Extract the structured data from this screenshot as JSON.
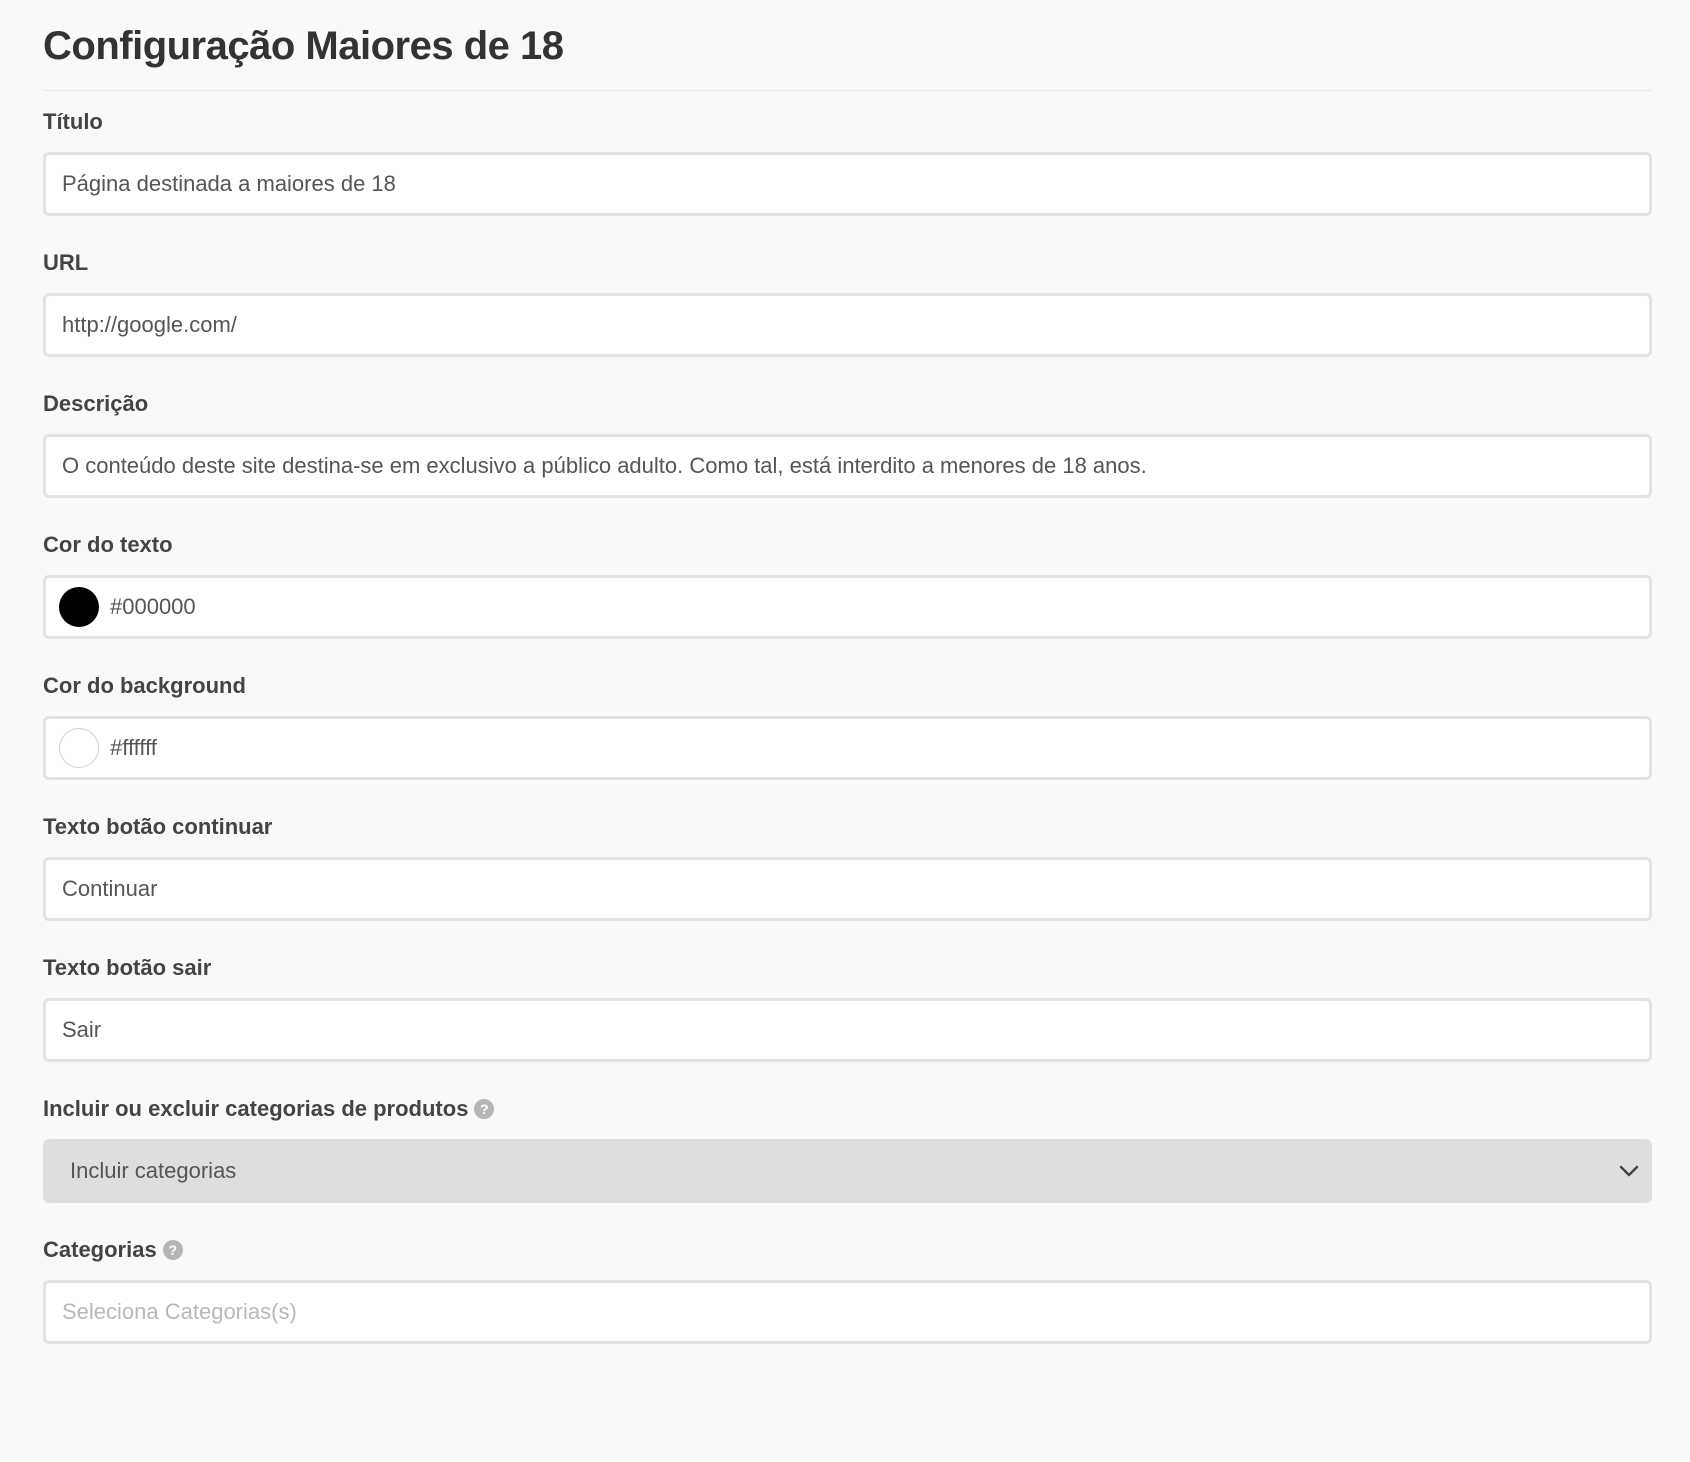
{
  "page": {
    "title": "Configuração Maiores de 18"
  },
  "fields": {
    "titulo": {
      "label": "Título",
      "value": "Página destinada a maiores de 18"
    },
    "url": {
      "label": "URL",
      "value": "http://google.com/"
    },
    "descricao": {
      "label": "Descrição",
      "value": "O conteúdo deste site destina-se em exclusivo a público adulto. Como tal, está interdito a menores de 18 anos."
    },
    "cor_texto": {
      "label": "Cor do texto",
      "value": "#000000",
      "swatch_color": "#000000"
    },
    "cor_background": {
      "label": "Cor do background",
      "value": "#ffffff",
      "swatch_color": "#ffffff"
    },
    "texto_continuar": {
      "label": "Texto botão continuar",
      "value": "Continuar"
    },
    "texto_sair": {
      "label": "Texto botão sair",
      "value": "Sair"
    },
    "incluir_excluir": {
      "label": "Incluir ou excluir categorias de produtos",
      "help_icon": "question-circle-icon",
      "selected": "Incluir categorias",
      "dropdown_icon": "chevron-down-icon"
    },
    "categorias": {
      "label": "Categorias",
      "help_icon": "question-circle-icon",
      "placeholder": "Seleciona Categorias(s)"
    }
  },
  "colors": {
    "background": "#f9f9f9",
    "input_border": "#e2e2e2",
    "select_background": "#dedede",
    "label_text": "#444444",
    "help_icon": "#b5b5b5"
  }
}
